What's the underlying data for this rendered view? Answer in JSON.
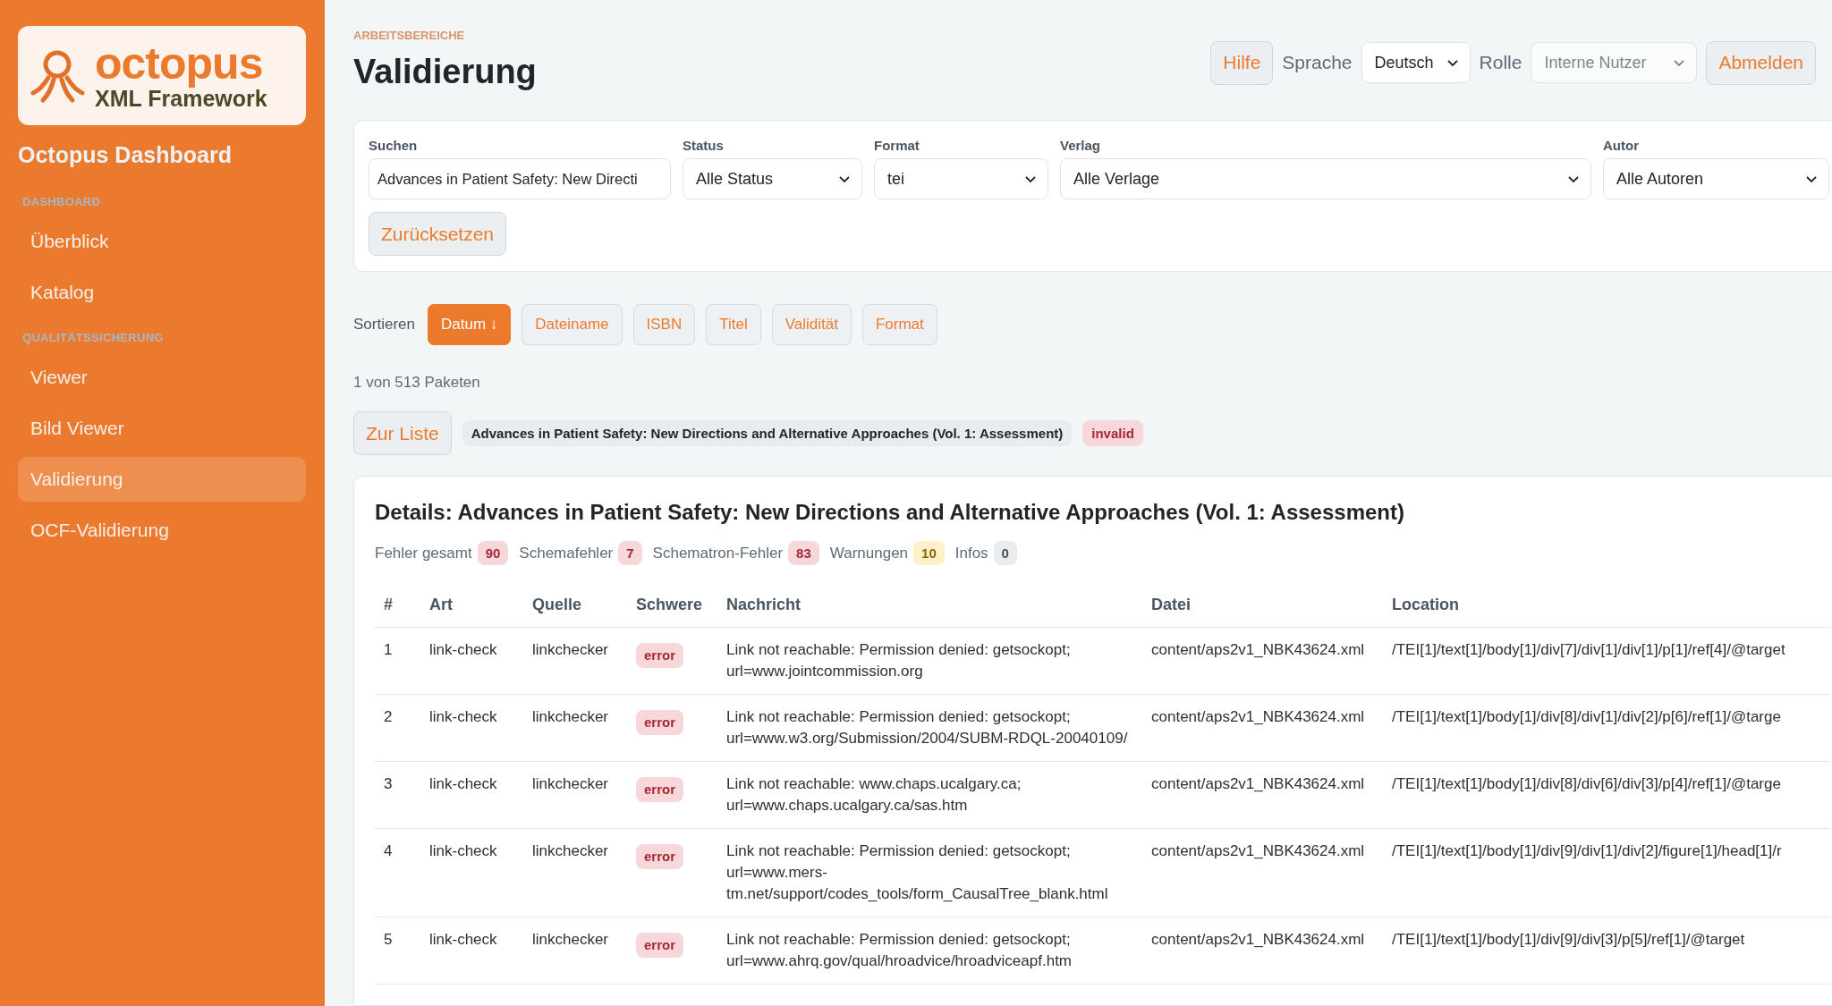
{
  "sidebar": {
    "logo": {
      "name": "octopus",
      "subtitle": "XML Framework"
    },
    "title": "Octopus Dashboard",
    "sections": [
      {
        "heading": "DASHBOARD",
        "items": [
          {
            "label": "Überblick",
            "selected": false
          },
          {
            "label": "Katalog",
            "selected": false
          }
        ]
      },
      {
        "heading": "QUALITÄTSSICHERUNG",
        "items": [
          {
            "label": "Viewer",
            "selected": false
          },
          {
            "label": "Bild Viewer",
            "selected": false
          },
          {
            "label": "Validierung",
            "selected": true
          },
          {
            "label": "OCF-Validierung",
            "selected": false
          }
        ]
      }
    ]
  },
  "header": {
    "eyebrow": "ARBEITSBEREICHE",
    "title": "Validierung",
    "help_button": "Hilfe",
    "language_label": "Sprache",
    "language": {
      "value": "Deutsch",
      "disabled": false
    },
    "role_label": "Rolle",
    "role": {
      "value": "Interne Nutzer",
      "disabled": true
    },
    "logout_button": "Abmelden"
  },
  "filters": {
    "fields": [
      {
        "kind": "text",
        "label": "Suchen",
        "value": "Advances in Patient Safety: New Directi"
      },
      {
        "kind": "select",
        "label": "Status",
        "value": "Alle Status"
      },
      {
        "kind": "select",
        "label": "Format",
        "value": "tei"
      },
      {
        "kind": "select",
        "label": "Verlag",
        "value": "Alle Verlage"
      },
      {
        "kind": "select",
        "label": "Autor",
        "value": "Alle Autoren"
      }
    ],
    "reset_button": "Zurücksetzen"
  },
  "sort": {
    "label": "Sortieren",
    "options": [
      {
        "label": "Datum ↓",
        "selected": true
      },
      {
        "label": "Dateiname",
        "selected": false
      },
      {
        "label": "ISBN",
        "selected": false
      },
      {
        "label": "Titel",
        "selected": false
      },
      {
        "label": "Validität",
        "selected": false
      },
      {
        "label": "Format",
        "selected": false
      }
    ]
  },
  "result_count": "1 von 513 Paketen",
  "package": {
    "back_button": "Zur Liste",
    "title": "Advances in Patient Safety: New Directions and Alternative Approaches (Vol. 1: Assessment)",
    "status": {
      "label": "invalid",
      "kind": "error"
    }
  },
  "details": {
    "title": "Details: Advances in Patient Safety: New Directions and Alternative Approaches (Vol. 1: Assessment)",
    "stats": [
      {
        "label": "Fehler gesamt",
        "count": "90",
        "kind": "error"
      },
      {
        "label": "Schemafehler",
        "count": "7",
        "kind": "error"
      },
      {
        "label": "Schematron-Fehler",
        "count": "83",
        "kind": "error"
      },
      {
        "label": "Warnungen",
        "count": "10",
        "kind": "warning"
      },
      {
        "label": "Infos",
        "count": "0",
        "kind": "info"
      }
    ],
    "table": {
      "columns": [
        "#",
        "Art",
        "Quelle",
        "Schwere",
        "Nachricht",
        "Datei",
        "Location"
      ],
      "rows": [
        {
          "number": "1",
          "type": "link-check",
          "source": "linkchecker",
          "severity": "error",
          "message": "Link not reachable: Permission denied: getsockopt; url=www.jointcommission.org",
          "file": "content/aps2v1_NBK43624.xml",
          "location": "/TEI[1]/text[1]/body[1]/div[7]/div[1]/div[1]/p[1]/ref[4]/@target"
        },
        {
          "number": "2",
          "type": "link-check",
          "source": "linkchecker",
          "severity": "error",
          "message": "Link not reachable: Permission denied: getsockopt; url=www.w3.org/Submission/2004/SUBM-RDQL-20040109/",
          "file": "content/aps2v1_NBK43624.xml",
          "location": "/TEI[1]/text[1]/body[1]/div[8]/div[1]/div[2]/p[6]/ref[1]/@targe"
        },
        {
          "number": "3",
          "type": "link-check",
          "source": "linkchecker",
          "severity": "error",
          "message": "Link not reachable: www.chaps.ucalgary.ca; url=www.chaps.ucalgary.ca/sas.htm",
          "file": "content/aps2v1_NBK43624.xml",
          "location": "/TEI[1]/text[1]/body[1]/div[8]/div[6]/div[3]/p[4]/ref[1]/@targe"
        },
        {
          "number": "4",
          "type": "link-check",
          "source": "linkchecker",
          "severity": "error",
          "message": "Link not reachable: Permission denied: getsockopt; url=www.mers-tm.net/support/codes_tools/form_CausalTree_blank.html",
          "file": "content/aps2v1_NBK43624.xml",
          "location": "/TEI[1]/text[1]/body[1]/div[9]/div[1]/div[2]/figure[1]/head[1]/r"
        },
        {
          "number": "5",
          "type": "link-check",
          "source": "linkchecker",
          "severity": "error",
          "message": "Link not reachable: Permission denied: getsockopt; url=www.ahrq.gov/qual/hroadvice/hroadviceapf.htm",
          "file": "content/aps2v1_NBK43624.xml",
          "location": "/TEI[1]/text[1]/body[1]/div[9]/div[3]/p[5]/ref[1]/@target"
        }
      ]
    }
  }
}
